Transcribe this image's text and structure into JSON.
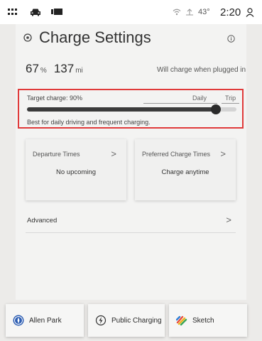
{
  "status_bar": {
    "temperature": "43°",
    "time": "2:20",
    "icons": [
      "apps-grid-icon",
      "car-icon",
      "media-icon",
      "wifi-icon",
      "signal-icon",
      "user-icon"
    ]
  },
  "header": {
    "title": "Charge Settings",
    "title_icon": "charge-settings-icon",
    "info_icon": "info-icon"
  },
  "stats": {
    "battery_value": "67",
    "battery_unit": "%",
    "range_value": "137",
    "range_unit": "mi",
    "plug_status": "Will charge when plugged in"
  },
  "charge_target": {
    "label": "Target charge: 90%",
    "daily_label": "Daily",
    "trip_label": "Trip",
    "slider_value_percent": 90,
    "description": "Best for daily driving and frequent charging.",
    "highlight_color": "#e03a3a"
  },
  "tiles": [
    {
      "label": "Departure Times",
      "value": "No upcoming"
    },
    {
      "label": "Preferred Charge Times",
      "value": "Charge anytime"
    }
  ],
  "advanced": {
    "label": "Advanced"
  },
  "chevron": ">",
  "dock": [
    {
      "label": "Allen Park",
      "icon": "compass-icon"
    },
    {
      "label": "Public Charging",
      "icon": "charging-bolt-icon"
    },
    {
      "label": "Sketch",
      "icon": "sketch-app-icon"
    }
  ]
}
